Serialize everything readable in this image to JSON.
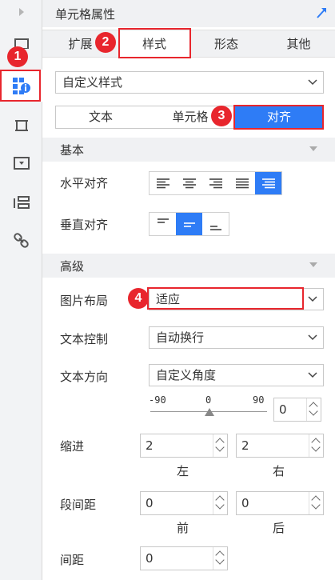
{
  "panel": {
    "title": "单元格属性"
  },
  "tabs": [
    {
      "label": "扩展"
    },
    {
      "label": "样式"
    },
    {
      "label": "形态"
    },
    {
      "label": "其他"
    }
  ],
  "style_select": {
    "value": "自定义样式"
  },
  "subtabs": [
    {
      "label": "文本"
    },
    {
      "label": "单元格"
    },
    {
      "label": "对齐"
    }
  ],
  "basic": {
    "header": "基本",
    "h_align_label": "水平对齐",
    "v_align_label": "垂直对齐"
  },
  "advanced": {
    "header": "高级",
    "image_layout_label": "图片布局",
    "image_layout_value": "适应",
    "text_control_label": "文本控制",
    "text_control_value": "自动换行",
    "text_direction_label": "文本方向",
    "text_direction_value": "自定义角度",
    "slider": {
      "min_label": "-90",
      "mid_label": "0",
      "max_label": "90",
      "value": 0
    },
    "angle_value": "0",
    "indent_label": "缩进",
    "indent_left": "2",
    "indent_right": "2",
    "left_label": "左",
    "right_label": "右",
    "para_spacing_label": "段间距",
    "para_before": "0",
    "para_after": "0",
    "before_label": "前",
    "after_label": "后",
    "spacing_label": "间距",
    "spacing_value": "0"
  },
  "badges": {
    "b1": "1",
    "b2": "2",
    "b3": "3",
    "b4": "4"
  },
  "colors": {
    "accent": "#2e7cf6",
    "highlight": "#e8262d",
    "panel_bg": "#f0f1f3"
  }
}
